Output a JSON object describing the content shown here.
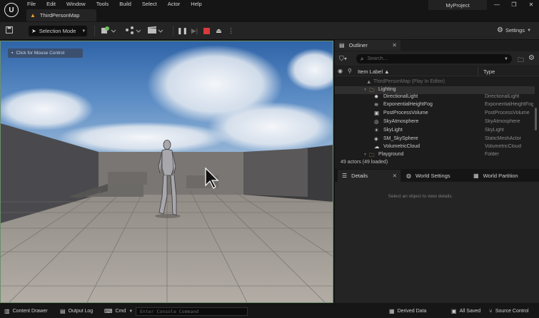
{
  "menu": [
    "File",
    "Edit",
    "Window",
    "Tools",
    "Build",
    "Select",
    "Actor",
    "Help"
  ],
  "map_tab": {
    "label": "ThirdPersonMap"
  },
  "project_name": "MyProject",
  "toolbar": {
    "selection_mode_label": "Selection Mode",
    "settings_label": "Settings"
  },
  "viewport": {
    "hint": "Click for Mouse Control"
  },
  "outliner": {
    "tab_label": "Outliner",
    "search_placeholder": "Search...",
    "col_item_label": "Item Label ▲",
    "col_type": "Type",
    "rows": [
      {
        "label": "ThirdPersonMap (Play In Editor)",
        "type": "",
        "icon": "map-icon"
      },
      {
        "label": "Lighting",
        "type": "",
        "icon": "folder-icon"
      },
      {
        "label": "DirectionalLight",
        "type": "DirectionalLight",
        "icon": "sun-icon"
      },
      {
        "label": "ExponentialHeightFog",
        "type": "ExponentialHeightFog",
        "icon": "fog-icon"
      },
      {
        "label": "PostProcessVolume",
        "type": "PostProcessVolume",
        "icon": "volume-icon"
      },
      {
        "label": "SkyAtmosphere",
        "type": "SkyAtmosphere",
        "icon": "atmosphere-icon"
      },
      {
        "label": "SkyLight",
        "type": "SkyLight",
        "icon": "skylight-icon"
      },
      {
        "label": "SM_SkySphere",
        "type": "StaticMeshActor",
        "icon": "mesh-icon"
      },
      {
        "label": "VolumetricCloud",
        "type": "VolumetricCloud",
        "icon": "cloud-icon"
      },
      {
        "label": "Playground",
        "type": "Folder",
        "icon": "folder-icon"
      }
    ],
    "actor_count": "49 actors (49 loaded)"
  },
  "details": {
    "tab_details": "Details",
    "tab_world_settings": "World Settings",
    "tab_world_partition": "World Partition",
    "hint": "Select an object to view details."
  },
  "statusbar": {
    "content_drawer": "Content Drawer",
    "output_log": "Output Log",
    "cmd": "Cmd",
    "console_placeholder": "Enter Console Command",
    "derived_data": "Derived Data",
    "all_saved": "All Saved",
    "source_control": "Source Control"
  },
  "colors": {
    "accent_folder": "#c9a064",
    "play_stop": "#d93a3a",
    "viewport_border": "#6a8f6a"
  }
}
